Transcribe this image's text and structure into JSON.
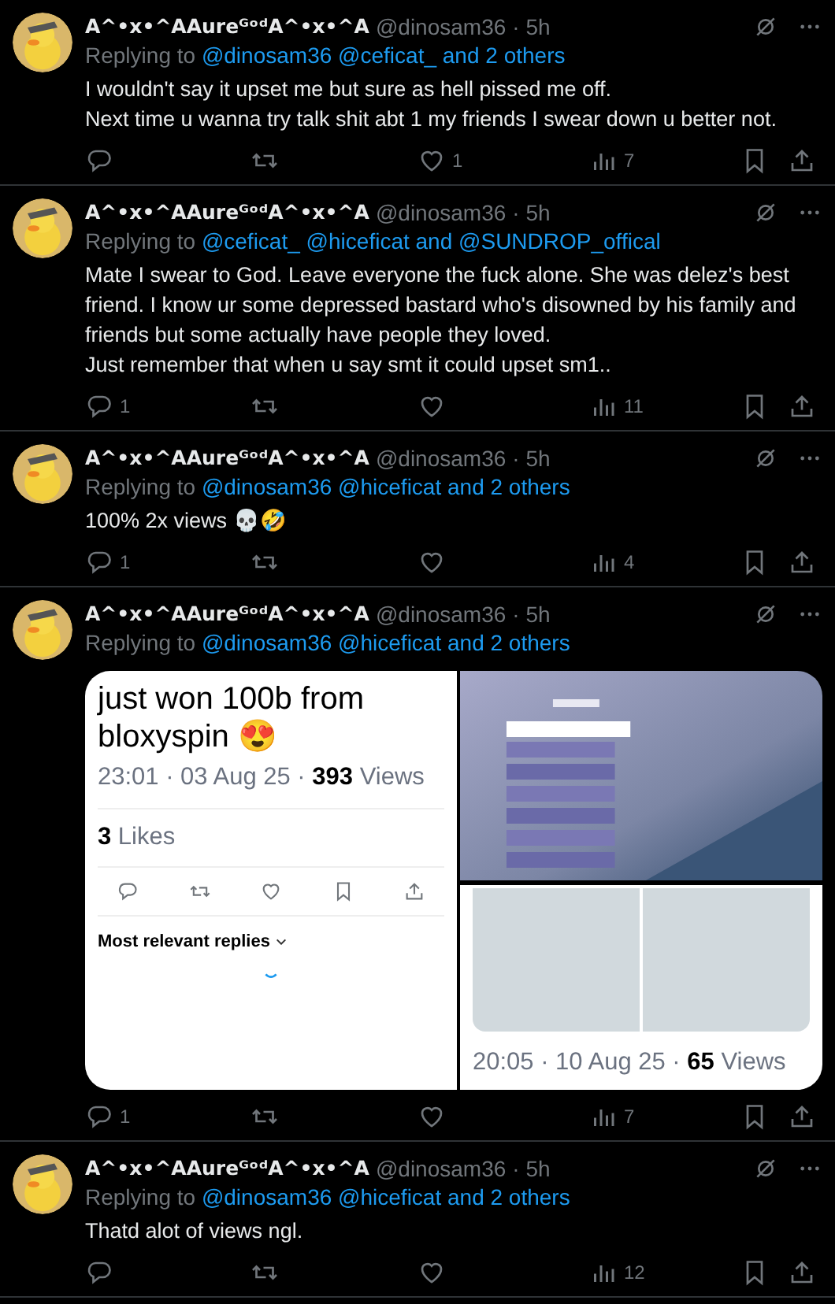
{
  "tweets": [
    {
      "author": {
        "display_name": "A^•x•^AAureᴳᵒᵈA^•x•^A",
        "handle": "@dinosam36",
        "time": "· 5h"
      },
      "replying_to": {
        "prefix": "Replying to",
        "mentions": [
          "@dinosam36",
          "@ceficat_",
          "and 2 others"
        ]
      },
      "lines": [
        "I wouldn't say it upset me but sure as hell pissed me off.",
        "Next time u wanna try talk shit abt 1 my friends I swear down u better not."
      ],
      "stats": {
        "likes": "1",
        "views": "7"
      }
    },
    {
      "author": {
        "display_name": "A^•x•^AAureᴳᵒᵈA^•x•^A",
        "handle": "@dinosam36",
        "time": "· 5h"
      },
      "replying_to": {
        "prefix": "Replying to",
        "mentions": [
          "@ceficat_",
          "@hiceficat",
          "and",
          "@SUNDROP_offical"
        ]
      },
      "lines": [
        "Mate I swear to God. Leave everyone the fuck alone. She was delez's best friend. I know ur some depressed bastard who's disowned by his family and friends but some actually have people they loved.",
        "Just remember that when u say smt it could upset sm1.."
      ],
      "stats": {
        "replies": "1",
        "views": "11"
      }
    },
    {
      "author": {
        "display_name": "A^•x•^AAureᴳᵒᵈA^•x•^A",
        "handle": "@dinosam36",
        "time": "· 5h"
      },
      "replying_to": {
        "prefix": "Replying to",
        "mentions": [
          "@dinosam36",
          "@hiceficat",
          "and 2 others"
        ]
      },
      "lines": [
        "100% 2x views 💀🤣"
      ],
      "stats": {
        "replies": "1",
        "views": "4"
      }
    },
    {
      "author": {
        "display_name": "A^•x•^AAureᴳᵒᵈA^•x•^A",
        "handle": "@dinosam36",
        "time": "· 5h"
      },
      "replying_to": {
        "prefix": "Replying to",
        "mentions": [
          "@dinosam36",
          "@hiceficat",
          "and 2 others"
        ]
      },
      "media": {
        "left": {
          "text": "just won 100b from bloxyspin 😍",
          "timestamp": "23:01 · 03 Aug 25 · ",
          "views_count": "393",
          "views_label": " Views",
          "likes_count": "3",
          "likes_label": " Likes",
          "replies_sort": "Most relevant replies"
        },
        "right": {
          "timestamp": "20:05 · 10 Aug 25 · ",
          "views_count": "65",
          "views_label": " Views"
        }
      },
      "stats": {
        "replies": "1",
        "views": "7"
      }
    },
    {
      "author": {
        "display_name": "A^•x•^AAureᴳᵒᵈA^•x•^A",
        "handle": "@dinosam36",
        "time": "· 5h"
      },
      "replying_to": {
        "prefix": "Replying to",
        "mentions": [
          "@dinosam36",
          "@hiceficat",
          "and 2 others"
        ]
      },
      "lines": [
        "Thatd alot of views ngl."
      ],
      "stats": {
        "views": "12"
      }
    }
  ]
}
